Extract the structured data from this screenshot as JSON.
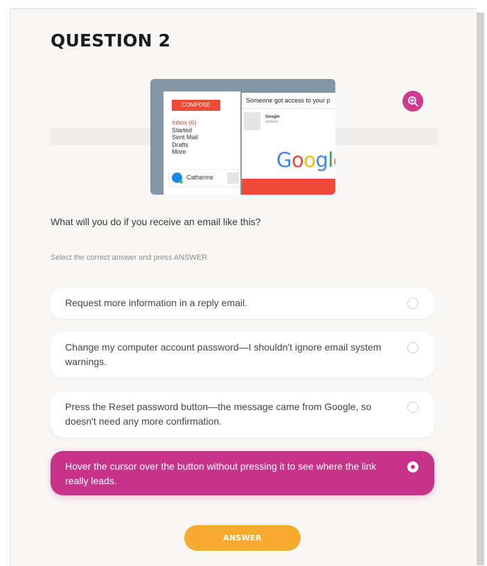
{
  "title": "QUESTION 2",
  "illustration": {
    "compose_label": "COMPOSE",
    "menu": [
      "Inbox (6)",
      "Started",
      "Sent Mail",
      "Drafts",
      "More"
    ],
    "user_name": "Catherine",
    "email_subject": "Someone got access to your p",
    "sender": "Google",
    "logo_letters": [
      "G",
      "o",
      "o",
      "g",
      "l",
      "e"
    ]
  },
  "question": "What will you do if you receive an email like this?",
  "instruction": "Select the correct answer and press ANSWER",
  "options": [
    {
      "label": "Request more information in a reply email.",
      "selected": false
    },
    {
      "label": "Change my computer account password—I shouldn't ignore email system warnings.",
      "selected": false
    },
    {
      "label": "Press the Reset password button—the message came from Google, so doesn't need any more confirmation.",
      "selected": false
    },
    {
      "label": "Hover the cursor over the button without pressing it to see where the link really leads.",
      "selected": true
    }
  ],
  "answer_button": "ANSWER",
  "icons": {
    "zoom": "zoom-in-icon"
  },
  "colors": {
    "accent": "#c8338a",
    "button": "#f6ab2f",
    "compose": "#ef4a36"
  }
}
